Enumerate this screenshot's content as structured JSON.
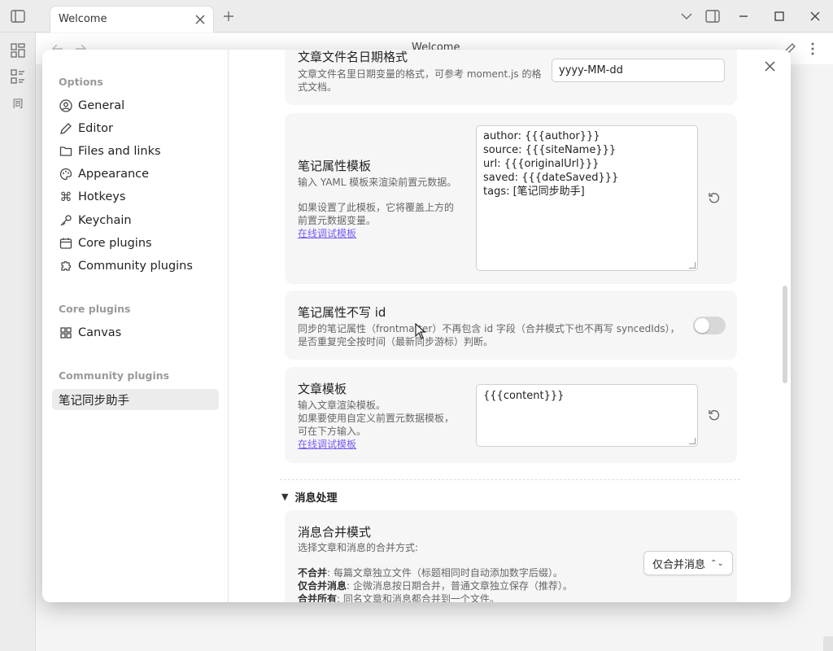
{
  "tab": {
    "label": "Welcome"
  },
  "view": {
    "title": "Welcome"
  },
  "ribbon": {
    "item3_glyph": "同"
  },
  "nav": {
    "heading_options": "Options",
    "options": [
      {
        "label": "General",
        "icon": "user-circle-icon"
      },
      {
        "label": "Editor",
        "icon": "pencil-icon"
      },
      {
        "label": "Files and links",
        "icon": "folder-icon"
      },
      {
        "label": "Appearance",
        "icon": "palette-icon"
      },
      {
        "label": "Hotkeys",
        "icon": "command-icon"
      },
      {
        "label": "Keychain",
        "icon": "key-icon"
      },
      {
        "label": "Core plugins",
        "icon": "calendar-icon"
      },
      {
        "label": "Community plugins",
        "icon": "puzzle-icon"
      }
    ],
    "heading_core": "Core plugins",
    "core": [
      {
        "label": "Canvas",
        "icon": "grid-icon"
      }
    ],
    "heading_community": "Community plugins",
    "community": [
      {
        "label": "笔记同步助手",
        "active": true
      }
    ]
  },
  "settings": {
    "date_format": {
      "title": "文章文件名日期格式",
      "desc1": "文章文件名里日期变量的格式，可参考 moment.js 的格",
      "desc2": "式文档。",
      "value": "yyyy-MM-dd"
    },
    "frontmatter_template": {
      "title": "笔记属性模板",
      "desc1": "输入 YAML 模板来渲染前置元数据。",
      "desc2": "如果设置了此模板，它将覆盖上方的",
      "desc3": "前置元数据变量。",
      "link": "在线调试模板",
      "lines": [
        "author: {{{author}}}",
        "source: {{{siteName}}}",
        "url: {{{originalUrl}}}",
        "saved: {{{dateSaved}}}",
        "tags: [笔记同步助手]"
      ]
    },
    "no_id": {
      "title": "笔记属性不写 id",
      "desc1": "同步的笔记属性（frontmatter）不再包含 id 字段（合并模式下也不再写 syncedIds），",
      "desc2": "是否重复完全按时间（最新同步游标）判断。",
      "enabled": false
    },
    "article_template": {
      "title": "文章模板",
      "desc1": "输入文章渲染模板。",
      "desc2": "如果要使用自定义前置元数据模板，",
      "desc3": "可在下方输入。",
      "link": "在线调试模板",
      "value": "{{{content}}}"
    },
    "section_message": {
      "title": "消息处理"
    },
    "merge_mode": {
      "title": "消息合并模式",
      "desc1": "选择文章和消息的合并方式:",
      "opt1_label": "不合并",
      "opt1_text": ": 每篇文章独立文件（标题相同时自动添加数字后缀）。",
      "opt2_label": "仅合并消息",
      "opt2_text": ": 企微消息按日期合并，普通文章独立保存（推荐）。",
      "opt3_label": "合并所有",
      "opt3_text": ": 同名文章和消息都合并到一个文件。",
      "selected": "仅合并消息"
    }
  }
}
